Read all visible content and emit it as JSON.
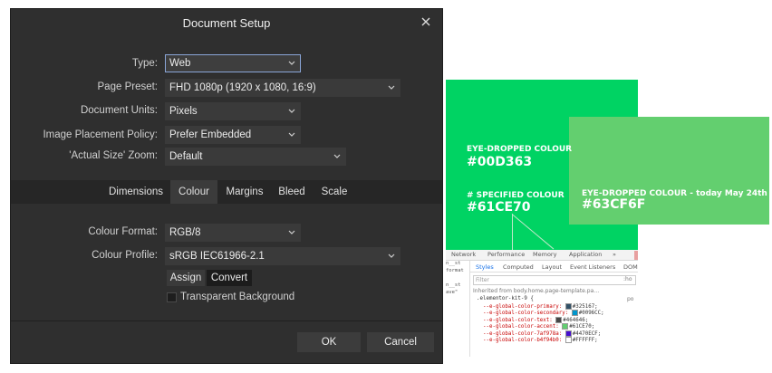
{
  "dialog": {
    "title": "Document Setup",
    "fields": {
      "type": {
        "label": "Type:",
        "value": "Web"
      },
      "page_preset": {
        "label": "Page Preset:",
        "value": "FHD 1080p  (1920 x 1080, 16:9)"
      },
      "document_units": {
        "label": "Document Units:",
        "value": "Pixels"
      },
      "image_placement": {
        "label": "Image Placement Policy:",
        "value": "Prefer Embedded"
      },
      "actual_size_zoom": {
        "label": "'Actual Size' Zoom:",
        "value": "Default"
      }
    },
    "tabs": [
      "Dimensions",
      "Colour",
      "Margins",
      "Bleed",
      "Scale"
    ],
    "active_tab": "Colour",
    "colour": {
      "format": {
        "label": "Colour Format:",
        "value": "RGB/8"
      },
      "profile": {
        "label": "Colour Profile:",
        "value": "sRGB IEC61966-2.1"
      },
      "assign_label": "Assign",
      "convert_label": "Convert",
      "transparent_label": "Transparent Background"
    },
    "ok_label": "OK",
    "cancel_label": "Cancel"
  },
  "background_page": {
    "caption1_small": "EYE-DROPPED COLOUR",
    "caption1_big": "#00D363",
    "caption2_small": "# SPECIFIED COLOUR",
    "caption2_big": "#61CE70",
    "caption3_small": "EYE-DROPPED COLOUR - today May 24th",
    "caption3_big": "#63CF6F",
    "colors": {
      "green_a": "#00D363",
      "green_b": "#63CF6F"
    },
    "devtools": {
      "top_tabs": [
        "Network",
        "Performance",
        "Memory",
        "Application",
        "»"
      ],
      "sub_tabs": [
        "Styles",
        "Computed",
        "Layout",
        "Event Listeners",
        "DOM"
      ],
      "filter_placeholder": "Filter",
      "filter_right": ":ho",
      "inherited": "Inherited from body.home.page-template.pa…",
      "side_lines": [
        "n__st",
        "format",
        "",
        "n__st",
        "ave\""
      ],
      "selector": ".elementor-kit-9 {",
      "selector_right": "po",
      "code": [
        {
          "prop": "--e-global-color-primary:",
          "swatch": "#325167",
          "val": "#325167;"
        },
        {
          "prop": "--e-global-color-secondary:",
          "swatch": "#0096CC",
          "val": "#0096CC;"
        },
        {
          "prop": "--e-global-color-text:",
          "swatch": "#464646",
          "val": "#464646;"
        },
        {
          "prop": "--e-global-color-accent:",
          "swatch": "#61CE70",
          "val": "#61CE70;"
        },
        {
          "prop": "--e-global-color-7af978a:",
          "swatch": "#4470ECF",
          "val": "#4470ECF;"
        },
        {
          "prop": "--e-global-color-b4f94b0:",
          "swatch": "#FFFFFF",
          "val": "#FFFFFF;"
        }
      ]
    }
  }
}
